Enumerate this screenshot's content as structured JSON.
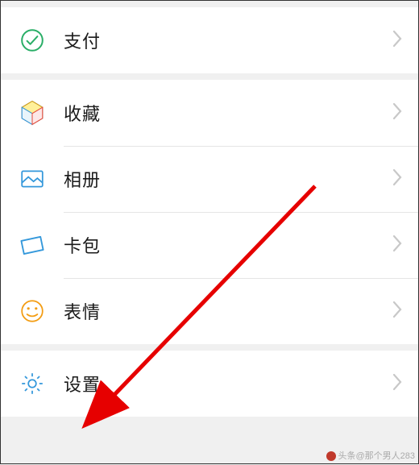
{
  "sections": [
    {
      "items": [
        {
          "name": "row-pay",
          "icon": "pay-icon",
          "label": "支付"
        }
      ]
    },
    {
      "items": [
        {
          "name": "row-favorites",
          "icon": "favorites-icon",
          "label": "收藏"
        },
        {
          "name": "row-album",
          "icon": "album-icon",
          "label": "相册"
        },
        {
          "name": "row-card",
          "icon": "card-icon",
          "label": "卡包"
        },
        {
          "name": "row-emoji",
          "icon": "emoji-icon",
          "label": "表情"
        }
      ]
    },
    {
      "items": [
        {
          "name": "row-settings",
          "icon": "settings-icon",
          "label": "设置"
        }
      ]
    }
  ],
  "footer": "头条@那个男人283"
}
